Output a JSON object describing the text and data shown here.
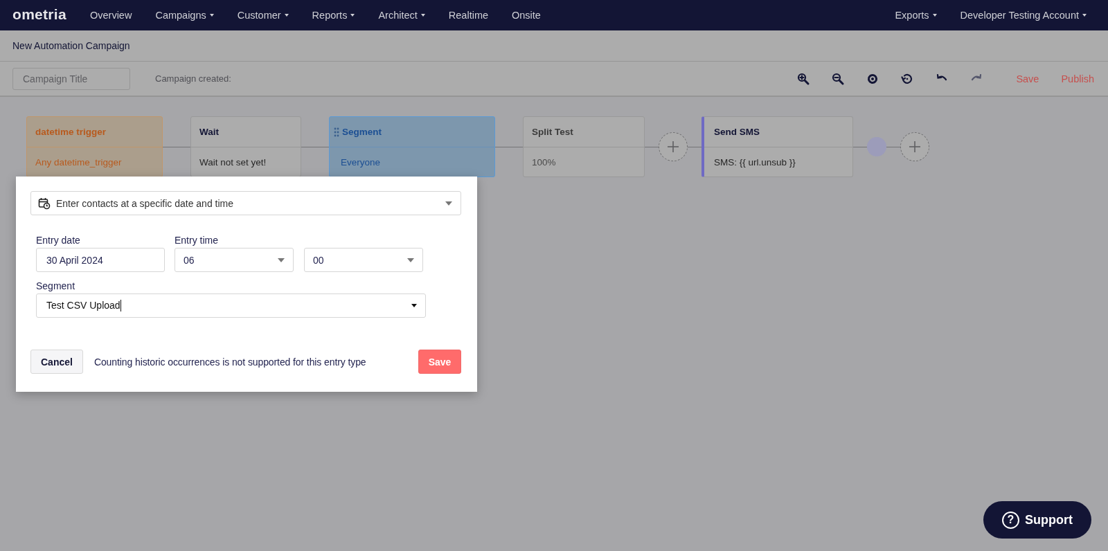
{
  "nav": {
    "logo": "ometria",
    "items": [
      {
        "label": "Overview",
        "has_menu": false
      },
      {
        "label": "Campaigns",
        "has_menu": true
      },
      {
        "label": "Customer",
        "has_menu": true
      },
      {
        "label": "Reports",
        "has_menu": true
      },
      {
        "label": "Architect",
        "has_menu": true
      },
      {
        "label": "Realtime",
        "has_menu": false
      },
      {
        "label": "Onsite",
        "has_menu": false
      }
    ],
    "right_items": [
      {
        "label": "Exports",
        "has_menu": true
      },
      {
        "label": "Developer Testing Account",
        "has_menu": true
      }
    ]
  },
  "page_title": "New Automation Campaign",
  "toolbar": {
    "title_field": {
      "placeholder": "Campaign Title"
    },
    "created_label": "Campaign created:",
    "tools": [
      {
        "kind": "zoom-in",
        "disabled": false
      },
      {
        "kind": "zoom-out",
        "disabled": false
      },
      {
        "kind": "settings",
        "disabled": false
      },
      {
        "kind": "history",
        "disabled": false
      },
      {
        "kind": "undo",
        "disabled": false
      },
      {
        "kind": "redo",
        "disabled": true
      }
    ],
    "actions": [
      "Save",
      "Publish"
    ]
  },
  "flow": [
    {
      "kind": "trigger",
      "title": "datetime trigger",
      "body": "Any datetime_trigger",
      "selected": false
    },
    {
      "kind": "step",
      "title": "Wait",
      "body": "Wait not set yet!",
      "selected": false
    },
    {
      "kind": "step",
      "title": "Segment",
      "body": "Everyone",
      "selected": true
    },
    {
      "kind": "step",
      "title": "Split Test",
      "body": "100%",
      "selected": false
    },
    {
      "kind": "add"
    },
    {
      "kind": "sms",
      "title": "Send SMS",
      "body": "SMS: {{ url.unsub }}",
      "selected": false
    },
    {
      "kind": "end"
    },
    {
      "kind": "add"
    }
  ],
  "dialog": {
    "entry_type": "Enter contacts at a specific date and time",
    "entry_date": {
      "label": "Entry date",
      "value": "30 April 2024"
    },
    "entry_time": {
      "label": "Entry time",
      "hour": "06",
      "minute": "00"
    },
    "segment": {
      "label": "Segment",
      "value": "Test CSV Upload"
    },
    "cancel": "Cancel",
    "note": "Counting historic occurrences is not supported for this entry type",
    "save": "Save"
  },
  "support": {
    "icon_glyph": "?",
    "label": "Support"
  }
}
